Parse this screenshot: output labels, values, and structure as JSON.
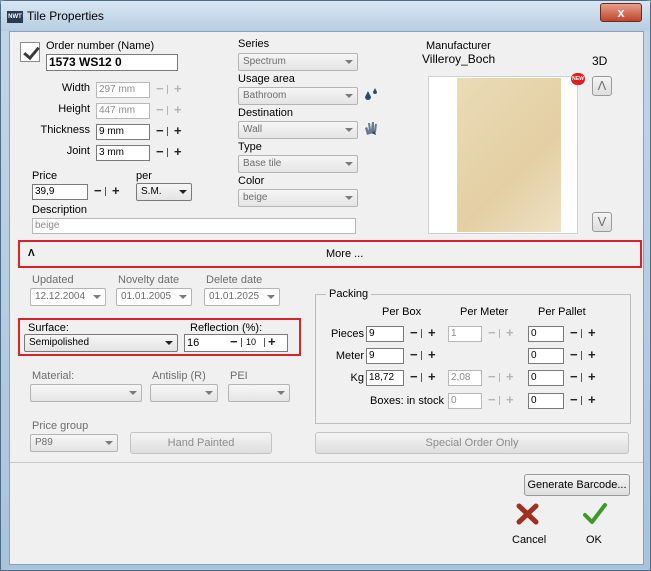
{
  "window": {
    "title": "Tile Properties",
    "app_icon": "app-logo-icon",
    "close_label": "x"
  },
  "order": {
    "label": "Order number (Name)",
    "value": "1573 WS12 0",
    "checked": true
  },
  "dims": {
    "width_label": "Width",
    "width_value": "297 mm",
    "height_label": "Height",
    "height_value": "447 mm",
    "thickness_label": "Thickness",
    "thickness_value": "9 mm",
    "joint_label": "Joint",
    "joint_value": "3 mm"
  },
  "price": {
    "label": "Price",
    "value": "39,9",
    "per_label": "per",
    "per_value": "S.M."
  },
  "description": {
    "label": "Description",
    "value": "beige"
  },
  "series": {
    "label": "Series",
    "value": "Spectrum"
  },
  "usage": {
    "label": "Usage area",
    "value": "Bathroom"
  },
  "destination": {
    "label": "Destination",
    "value": "Wall"
  },
  "type": {
    "label": "Type",
    "value": "Base tile"
  },
  "color": {
    "label": "Color",
    "value": "beige"
  },
  "manufacturer": {
    "label": "Manufacturer",
    "value": "Villeroy_Boch"
  },
  "preview": {
    "label_3d": "3D",
    "badge": "NEW",
    "up": "Λ",
    "down": "V"
  },
  "more": {
    "toggle": "Λ",
    "label": "More ..."
  },
  "dates": {
    "updated_label": "Updated",
    "updated_value": "12.12.2004",
    "novelty_label": "Novelty date",
    "novelty_value": "01.01.2005",
    "delete_label": "Delete date",
    "delete_value": "01.01.2025"
  },
  "surface": {
    "label": "Surface:",
    "value": "Semipolished",
    "reflection_label": "Reflection (%):",
    "reflection_value": "16",
    "reflection_step": "10"
  },
  "material": {
    "label": "Material:",
    "value": ""
  },
  "antislip": {
    "label": "Antislip (R)",
    "value": ""
  },
  "pei": {
    "label": "PEI",
    "value": ""
  },
  "price_group": {
    "label": "Price group",
    "value": "P89"
  },
  "hand_painted": {
    "label": "Hand Painted"
  },
  "special_order": {
    "label": "Special Order Only"
  },
  "packing": {
    "title": "Packing",
    "per_box": "Per Box",
    "per_meter": "Per Meter",
    "per_pallet": "Per Pallet",
    "pieces_label": "Pieces",
    "meter_label": "Meter",
    "kg_label": "Kg",
    "boxes_label": "Boxes: in stock",
    "pieces_box": "9",
    "pieces_meter": "1",
    "pieces_pallet": "0",
    "meter_box": "9",
    "meter_pallet": "0",
    "kg_box": "18,72",
    "kg_meter": "2,08",
    "kg_pallet": "0",
    "boxes_stock": "0",
    "boxes_pallet": "0"
  },
  "generate_barcode": {
    "label": "Generate Barcode..."
  },
  "cancel": {
    "label": "Cancel",
    "icon": "cross-icon",
    "color": "#a03020"
  },
  "ok": {
    "label": "OK",
    "icon": "checkmark-icon",
    "color": "#3d9a2a"
  },
  "accent": {
    "highlight": "#d8232a"
  }
}
